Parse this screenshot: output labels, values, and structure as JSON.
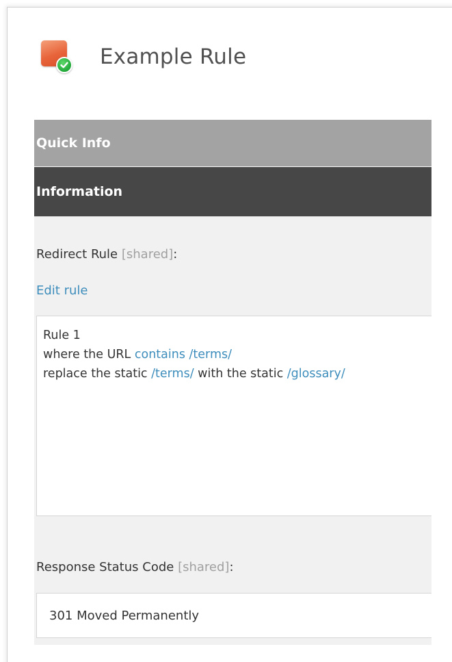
{
  "header": {
    "title": "Example Rule",
    "icon": "redirect-rule-icon"
  },
  "panels": {
    "quick_info": "Quick Info",
    "information": "Information"
  },
  "redirect_rule": {
    "label": "Redirect Rule",
    "shared": "[shared]",
    "colon": ":",
    "edit_link": "Edit rule",
    "rule_name": "Rule 1",
    "condition_prefix": "where the URL ",
    "condition_op": "contains",
    "condition_value": "/terms/",
    "action_prefix": "replace the static ",
    "action_from": "/terms/",
    "action_mid": " with the static ",
    "action_to": "/glossary/"
  },
  "response_status": {
    "label": "Response Status Code",
    "shared": "[shared]",
    "colon": ":",
    "value": "301 Moved Permanently"
  },
  "colors": {
    "link": "#3d8dbc",
    "quick_info_bar": "#a3a3a3",
    "information_bar": "#474747",
    "content_bg": "#f1f1f1"
  }
}
